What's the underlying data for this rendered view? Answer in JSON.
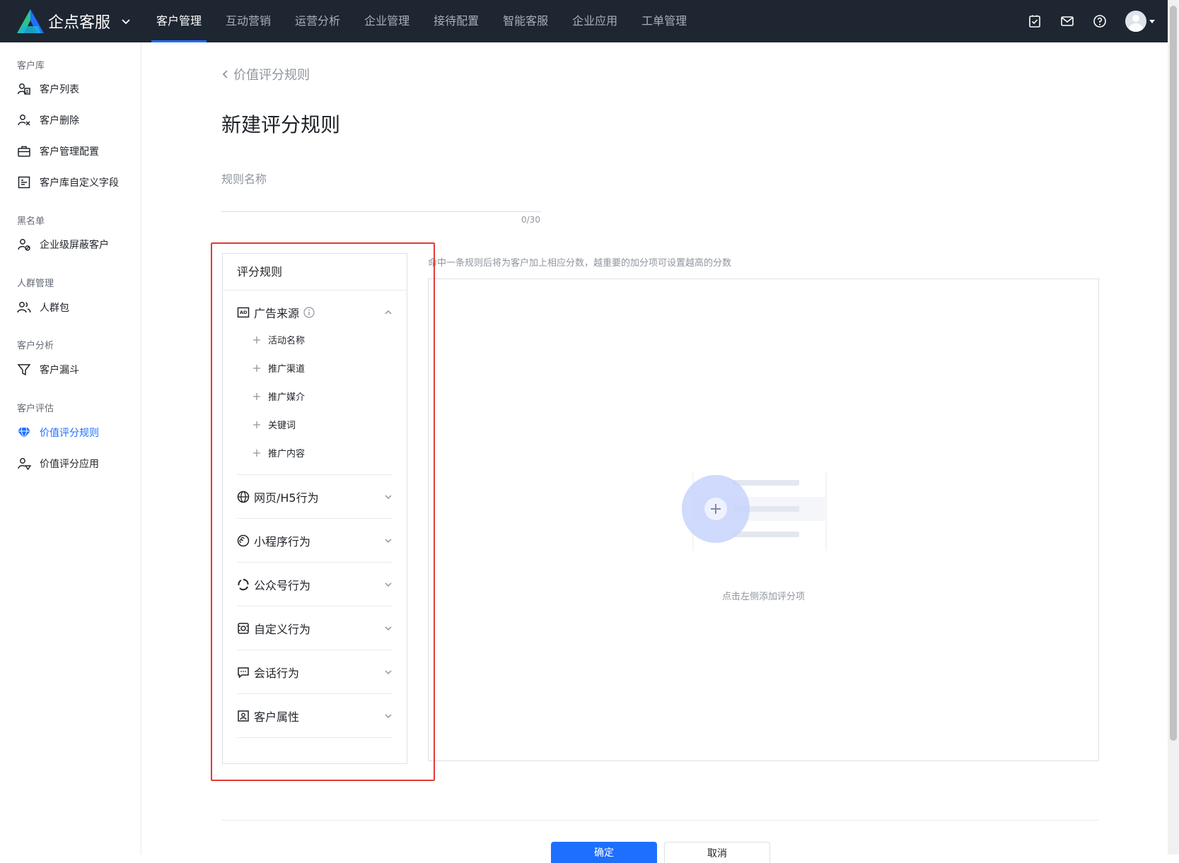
{
  "header": {
    "brand_name": "企点客服",
    "nav": [
      "客户管理",
      "互动营销",
      "运营分析",
      "企业管理",
      "接待配置",
      "智能客服",
      "企业应用",
      "工单管理"
    ],
    "active_nav_index": 0
  },
  "sidebar": {
    "groups": [
      {
        "label": "客户库",
        "items": [
          "客户列表",
          "客户删除",
          "客户管理配置",
          "客户库自定义字段"
        ]
      },
      {
        "label": "黑名单",
        "items": [
          "企业级屏蔽客户"
        ]
      },
      {
        "label": "人群管理",
        "items": [
          "人群包"
        ]
      },
      {
        "label": "客户分析",
        "items": [
          "客户漏斗"
        ]
      },
      {
        "label": "客户评估",
        "items": [
          "价值评分规则",
          "价值评分应用"
        ]
      }
    ],
    "active_item": "价值评分规则"
  },
  "page": {
    "back_label": "价值评分规则",
    "title": "新建评分规则",
    "name_field_label": "规则名称",
    "name_value": "",
    "name_counter": "0/30",
    "hint": "命中一条规则后将为客户加上相应分数，越重要的加分项可设置越高的分数",
    "empty_text": "点击左侧添加评分项",
    "confirm_label": "确定",
    "cancel_label": "取消"
  },
  "rules": {
    "title": "评分规则",
    "categories": [
      {
        "label": "广告来源",
        "icon": "ad-icon",
        "expanded": true,
        "subitems": [
          "活动名称",
          "推广渠道",
          "推广媒介",
          "关键词",
          "推广内容"
        ]
      },
      {
        "label": "网页/H5行为",
        "icon": "globe-icon",
        "expanded": false
      },
      {
        "label": "小程序行为",
        "icon": "mini-program-icon",
        "expanded": false
      },
      {
        "label": "公众号行为",
        "icon": "official-account-icon",
        "expanded": false
      },
      {
        "label": "自定义行为",
        "icon": "custom-behavior-icon",
        "expanded": false
      },
      {
        "label": "会话行为",
        "icon": "chat-icon",
        "expanded": false
      },
      {
        "label": "客户属性",
        "icon": "customer-attr-icon",
        "expanded": false
      }
    ]
  },
  "colors": {
    "topbar_bg": "#1e2631",
    "accent": "#1f6fff",
    "highlight_box": "#e53935"
  }
}
